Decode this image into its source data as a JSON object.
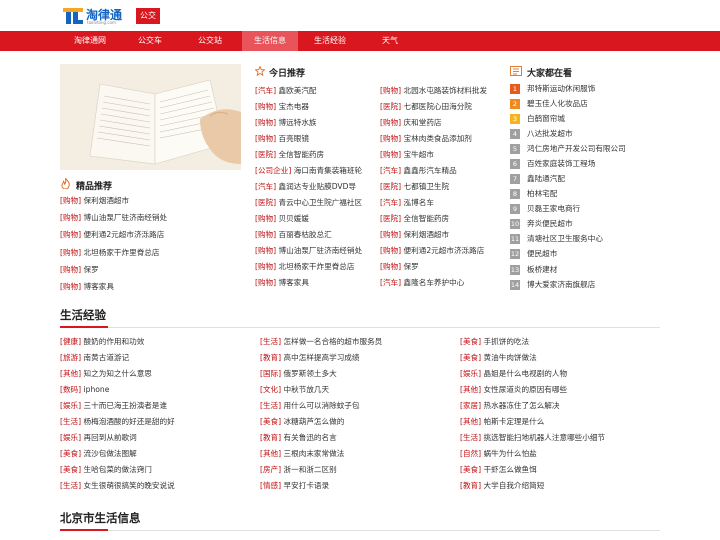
{
  "header": {
    "logo_text": "淘律通",
    "logo_sub": "taolvtong.com",
    "city_tag": "公交",
    "nav": [
      "淘律通网",
      "公交车",
      "公交站",
      "生活信息",
      "生活经验",
      "天气"
    ],
    "nav_active_index": 3
  },
  "featured": {
    "title": "精品推荐",
    "items": [
      {
        "tag": "购物",
        "text": "保利烟酒超市"
      },
      {
        "tag": "购物",
        "text": "博山油泵厂驻济南经销处"
      },
      {
        "tag": "购物",
        "text": "便利通2元超市济泺路店"
      },
      {
        "tag": "购物",
        "text": "北坦杨家干炸里脊总店"
      },
      {
        "tag": "购物",
        "text": "保罗"
      },
      {
        "tag": "购物",
        "text": "博客家具"
      }
    ]
  },
  "today": {
    "title": "今日推荐",
    "col1": [
      {
        "tag": "汽车",
        "text": "鑫欧美汽配"
      },
      {
        "tag": "购物",
        "text": "宝杰电器"
      },
      {
        "tag": "购物",
        "text": "博远特水族"
      },
      {
        "tag": "购物",
        "text": "百亮眼镜"
      },
      {
        "tag": "医院",
        "text": "全信智能药房"
      },
      {
        "tag": "公司企业",
        "text": "海口南青集装箱班轮"
      },
      {
        "tag": "汽车",
        "text": "鑫润达专业贴膜DVD导"
      },
      {
        "tag": "医院",
        "text": "青云中心卫生院广福社区"
      },
      {
        "tag": "购物",
        "text": "贝贝媛媛"
      },
      {
        "tag": "购物",
        "text": "百丽春枯胶总汇"
      },
      {
        "tag": "购物",
        "text": "博山油泵厂驻济南经销处"
      },
      {
        "tag": "购物",
        "text": "北坦杨家干炸里脊总店"
      },
      {
        "tag": "购物",
        "text": "博客家具"
      }
    ],
    "col2": [
      {
        "tag": "购物",
        "text": "北园水屯路装饰材料批发"
      },
      {
        "tag": "医院",
        "text": "七都医院心田海分院"
      },
      {
        "tag": "购物",
        "text": "庆和堂药店"
      },
      {
        "tag": "购物",
        "text": "宝林肉类食品添加剂"
      },
      {
        "tag": "购物",
        "text": "宝牛超市"
      },
      {
        "tag": "汽车",
        "text": "鑫鑫彤汽车精品"
      },
      {
        "tag": "医院",
        "text": "七都镇卫生院"
      },
      {
        "tag": "汽车",
        "text": "泓博名车"
      },
      {
        "tag": "医院",
        "text": "全信智能药房"
      },
      {
        "tag": "购物",
        "text": "保利烟酒超市"
      },
      {
        "tag": "购物",
        "text": "便利通2元超市济泺路店"
      },
      {
        "tag": "购物",
        "text": "保罗"
      },
      {
        "tag": "汽车",
        "text": "鑫隆名车养护中心"
      }
    ]
  },
  "popular": {
    "title": "大家都在看",
    "items": [
      "邦特斯运动休闲服饰",
      "碧玉佳人化妆品店",
      "白鹤窗帘城",
      "八达批发超市",
      "鸿仁房地产开发公司有限公司",
      "百姓家庭装饰工程场",
      "鑫陆通汽配",
      "柏林宅配",
      "贝磊王家电商行",
      "奔炎便民超市",
      "清塘社区卫生服务中心",
      "便民超市",
      "板桥建材",
      "博大爱家济南旗舰店"
    ]
  },
  "life": {
    "title": "生活经验",
    "col1": [
      {
        "tag": "健康",
        "text": "酸奶的作用和功效"
      },
      {
        "tag": "旅游",
        "text": "南黄古道游记"
      },
      {
        "tag": "其他",
        "text": "知之为知之什么意思"
      },
      {
        "tag": "数码",
        "text": "iphone"
      },
      {
        "tag": "娱乐",
        "text": "三十而已海王扮演者是谁"
      },
      {
        "tag": "生活",
        "text": "杨梅泡酒酸的好还是甜的好"
      },
      {
        "tag": "娱乐",
        "text": "再回到从前歌词"
      },
      {
        "tag": "美食",
        "text": "流沙包做法图解"
      },
      {
        "tag": "美食",
        "text": "生哈包菜的做法窍门"
      },
      {
        "tag": "生活",
        "text": "女生很萌很搞笑的晚安说说"
      }
    ],
    "col2": [
      {
        "tag": "生活",
        "text": "怎样做一名合格的超市服务员"
      },
      {
        "tag": "教育",
        "text": "高中怎样提高学习成绩"
      },
      {
        "tag": "国际",
        "text": "俄罗斯领土多大"
      },
      {
        "tag": "文化",
        "text": "中秋节放几天"
      },
      {
        "tag": "生活",
        "text": "用什么可以消除蚊子包"
      },
      {
        "tag": "美食",
        "text": "冰糖葫芦怎么做的"
      },
      {
        "tag": "教育",
        "text": "有关鲁迅的名言"
      },
      {
        "tag": "其他",
        "text": "三根肉末家常做法"
      },
      {
        "tag": "房产",
        "text": "浙一和浙二区别"
      },
      {
        "tag": "情感",
        "text": "早安打卡语录"
      }
    ],
    "col3": [
      {
        "tag": "美食",
        "text": "手抓饼的吃法"
      },
      {
        "tag": "美食",
        "text": "黄油牛肉饼做法"
      },
      {
        "tag": "娱乐",
        "text": "晶姐是什么电视剧的人物"
      },
      {
        "tag": "其他",
        "text": "女性尿道炎的原因有哪些"
      },
      {
        "tag": "家居",
        "text": "热水器冻住了怎么解决"
      },
      {
        "tag": "其他",
        "text": "帕斯卡定理是什么"
      },
      {
        "tag": "生活",
        "text": "挑选智能扫地机器人注意哪些小细节"
      },
      {
        "tag": "自然",
        "text": "蜗牛为什么怕盐"
      },
      {
        "tag": "美食",
        "text": "干虾怎么做鱼饵"
      },
      {
        "tag": "教育",
        "text": "大学自我介绍简短"
      }
    ]
  },
  "bottom": {
    "title": "北京市生活信息"
  },
  "colors": {
    "brand_red": "#d9171e",
    "tag_red": "#c01010",
    "nav_active": "#e8545a"
  }
}
